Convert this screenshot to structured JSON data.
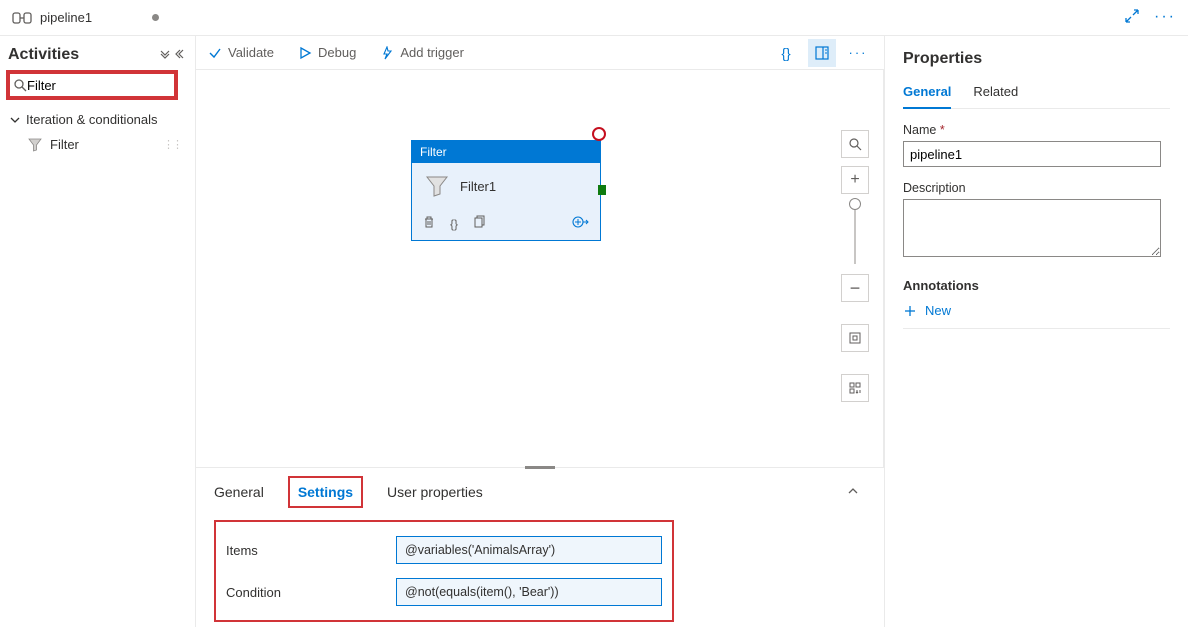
{
  "tab": {
    "title": "pipeline1"
  },
  "sidebar": {
    "title": "Activities",
    "search_value": "Filter",
    "group": "Iteration & conditionals",
    "item": "Filter"
  },
  "toolbar": {
    "validate": "Validate",
    "debug": "Debug",
    "add_trigger": "Add trigger"
  },
  "node": {
    "type": "Filter",
    "name": "Filter1"
  },
  "bottom": {
    "tabs": {
      "general": "General",
      "settings": "Settings",
      "user_props": "User properties"
    },
    "items_label": "Items",
    "condition_label": "Condition",
    "items_value": "@variables('AnimalsArray')",
    "condition_value": "@not(equals(item(), 'Bear'))"
  },
  "props": {
    "title": "Properties",
    "tabs": {
      "general": "General",
      "related": "Related"
    },
    "name_label": "Name",
    "name_value": "pipeline1",
    "desc_label": "Description",
    "annot_label": "Annotations",
    "new_label": "New"
  }
}
